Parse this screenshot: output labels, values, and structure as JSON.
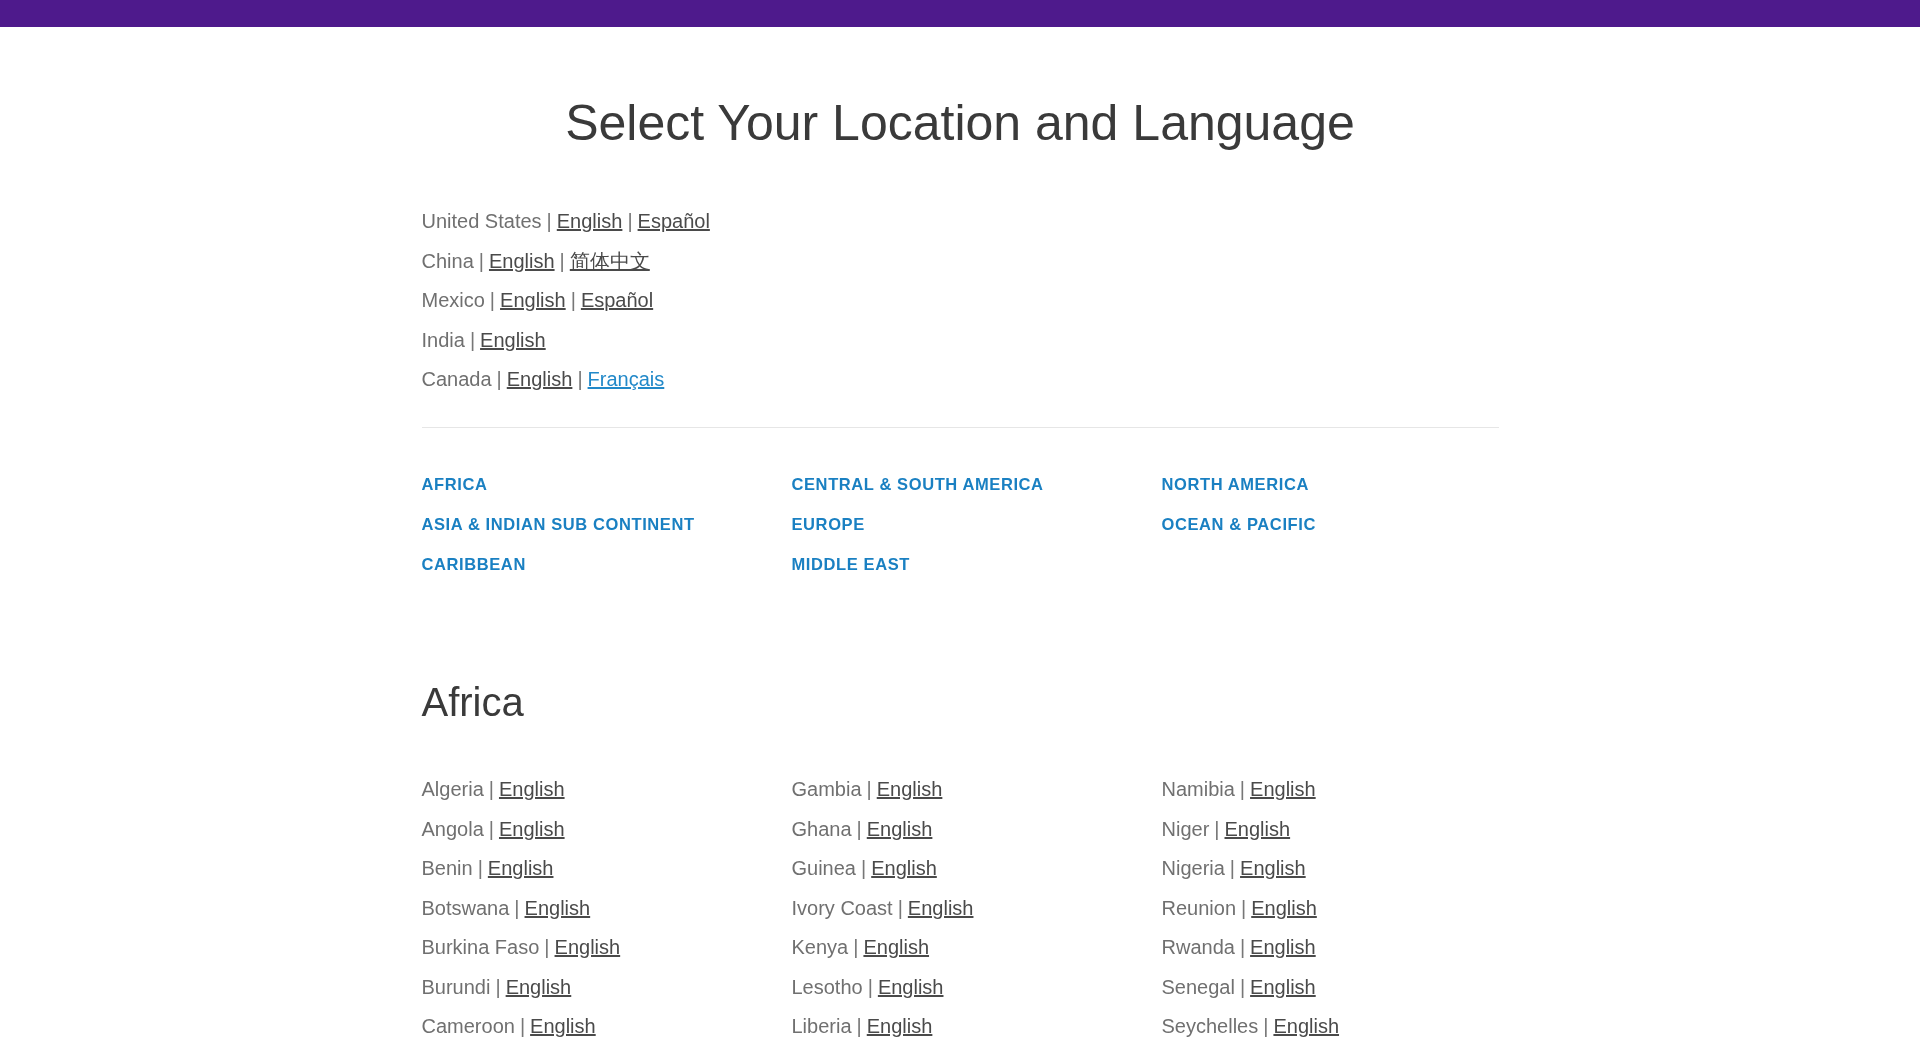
{
  "title": "Select Your Location and Language",
  "separator": "|",
  "featured": [
    {
      "country": "United States",
      "languages": [
        {
          "label": "English",
          "selected": false
        },
        {
          "label": "Español",
          "selected": false
        }
      ]
    },
    {
      "country": "China",
      "languages": [
        {
          "label": "English",
          "selected": false
        },
        {
          "label": "简体中文",
          "selected": false
        }
      ]
    },
    {
      "country": "Mexico",
      "languages": [
        {
          "label": "English",
          "selected": false
        },
        {
          "label": "Español",
          "selected": false
        }
      ]
    },
    {
      "country": "India",
      "languages": [
        {
          "label": "English",
          "selected": false
        }
      ]
    },
    {
      "country": "Canada",
      "languages": [
        {
          "label": "English",
          "selected": false
        },
        {
          "label": "Français",
          "selected": true
        }
      ]
    }
  ],
  "regions": [
    "AFRICA",
    "CENTRAL & SOUTH AMERICA",
    "NORTH AMERICA",
    "ASIA & INDIAN SUB CONTINENT",
    "EUROPE",
    "OCEAN & PACIFIC",
    "CARIBBEAN",
    "MIDDLE EAST"
  ],
  "section": {
    "heading": "Africa",
    "columns": [
      [
        {
          "country": "Algeria",
          "language": "English"
        },
        {
          "country": "Angola",
          "language": "English"
        },
        {
          "country": "Benin",
          "language": "English"
        },
        {
          "country": "Botswana",
          "language": "English"
        },
        {
          "country": "Burkina Faso",
          "language": "English"
        },
        {
          "country": "Burundi",
          "language": "English"
        },
        {
          "country": "Cameroon",
          "language": "English"
        }
      ],
      [
        {
          "country": "Gambia",
          "language": "English"
        },
        {
          "country": "Ghana",
          "language": "English"
        },
        {
          "country": "Guinea",
          "language": "English"
        },
        {
          "country": "Ivory Coast",
          "language": "English"
        },
        {
          "country": "Kenya",
          "language": "English"
        },
        {
          "country": "Lesotho",
          "language": "English"
        },
        {
          "country": "Liberia",
          "language": "English"
        }
      ],
      [
        {
          "country": "Namibia",
          "language": "English"
        },
        {
          "country": "Niger",
          "language": "English"
        },
        {
          "country": "Nigeria",
          "language": "English"
        },
        {
          "country": "Reunion",
          "language": "English"
        },
        {
          "country": "Rwanda",
          "language": "English"
        },
        {
          "country": "Senegal",
          "language": "English"
        },
        {
          "country": "Seychelles",
          "language": "English"
        }
      ]
    ]
  }
}
